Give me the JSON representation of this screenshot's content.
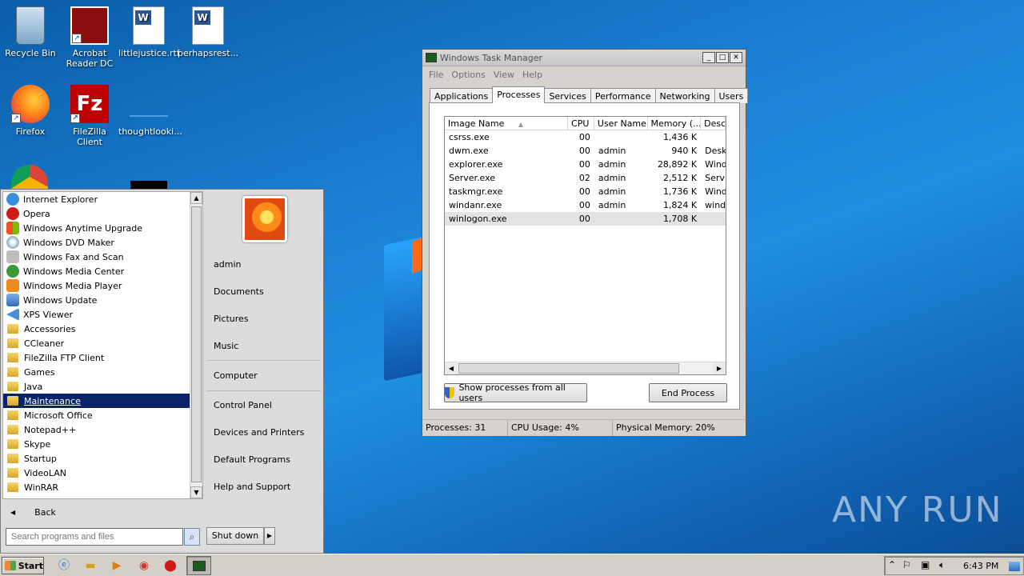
{
  "desktop": {
    "icons": [
      {
        "label": "Recycle Bin"
      },
      {
        "label": "Acrobat\nReader DC"
      },
      {
        "label": "littlejustice.rtf"
      },
      {
        "label": "perhapsrest..."
      },
      {
        "label": "Firefox"
      },
      {
        "label": "FileZilla Client"
      },
      {
        "label": "thoughtlooki..."
      }
    ],
    "watermark": "ANY RUN"
  },
  "start_menu": {
    "programs": [
      {
        "label": "Internet Explorer",
        "icon": "ie-icon"
      },
      {
        "label": "Opera",
        "icon": "opera-icon"
      },
      {
        "label": "Windows Anytime Upgrade",
        "icon": "windows-icon"
      },
      {
        "label": "Windows DVD Maker",
        "icon": "dvd-icon"
      },
      {
        "label": "Windows Fax and Scan",
        "icon": "fax-icon"
      },
      {
        "label": "Windows Media Center",
        "icon": "media-center-icon"
      },
      {
        "label": "Windows Media Player",
        "icon": "media-player-icon"
      },
      {
        "label": "Windows Update",
        "icon": "update-icon"
      },
      {
        "label": "XPS Viewer",
        "icon": "xps-icon"
      },
      {
        "label": "Accessories",
        "icon": "folder-icon"
      },
      {
        "label": "CCleaner",
        "icon": "folder-icon"
      },
      {
        "label": "FileZilla FTP Client",
        "icon": "folder-icon"
      },
      {
        "label": "Games",
        "icon": "folder-icon"
      },
      {
        "label": "Java",
        "icon": "folder-icon"
      },
      {
        "label": "Maintenance",
        "icon": "folder-icon"
      },
      {
        "label": "Microsoft Office",
        "icon": "folder-icon"
      },
      {
        "label": "Notepad++",
        "icon": "folder-icon"
      },
      {
        "label": "Skype",
        "icon": "folder-icon"
      },
      {
        "label": "Startup",
        "icon": "folder-icon"
      },
      {
        "label": "VideoLAN",
        "icon": "folder-icon"
      },
      {
        "label": "WinRAR",
        "icon": "folder-icon"
      }
    ],
    "selected": "Maintenance",
    "back_label": "Back",
    "search_placeholder": "Search programs and files",
    "right_links": {
      "user": "admin",
      "documents": "Documents",
      "pictures": "Pictures",
      "music": "Music",
      "computer": "Computer",
      "control_panel": "Control Panel",
      "devices": "Devices and Printers",
      "default_programs": "Default Programs",
      "help": "Help and Support"
    },
    "shutdown_label": "Shut down"
  },
  "task_manager": {
    "title": "Windows Task Manager",
    "menu": [
      "File",
      "Options",
      "View",
      "Help"
    ],
    "tabs": [
      "Applications",
      "Processes",
      "Services",
      "Performance",
      "Networking",
      "Users"
    ],
    "active_tab": "Processes",
    "columns": [
      "Image Name",
      "CPU",
      "User Name",
      "Memory (...",
      "Desc"
    ],
    "rows": [
      {
        "name": "csrss.exe",
        "cpu": "00",
        "user": "",
        "mem": "1,436 K",
        "desc": ""
      },
      {
        "name": "dwm.exe",
        "cpu": "00",
        "user": "admin",
        "mem": "940 K",
        "desc": "Desk"
      },
      {
        "name": "explorer.exe",
        "cpu": "00",
        "user": "admin",
        "mem": "28,892 K",
        "desc": "Wind"
      },
      {
        "name": "Server.exe",
        "cpu": "02",
        "user": "admin",
        "mem": "2,512 K",
        "desc": "Serv"
      },
      {
        "name": "taskmgr.exe",
        "cpu": "00",
        "user": "admin",
        "mem": "1,736 K",
        "desc": "Wind"
      },
      {
        "name": "windanr.exe",
        "cpu": "00",
        "user": "admin",
        "mem": "1,824 K",
        "desc": "wind"
      },
      {
        "name": "winlogon.exe",
        "cpu": "00",
        "user": "",
        "mem": "1,708 K",
        "desc": ""
      }
    ],
    "selected_row": "winlogon.exe",
    "show_all_label": "Show processes from all users",
    "end_process_label": "End Process",
    "status": {
      "processes": "Processes: 31",
      "cpu": "CPU Usage: 4%",
      "memory": "Physical Memory: 20%"
    }
  },
  "taskbar": {
    "start_label": "Start",
    "clock": "6:43 PM"
  }
}
